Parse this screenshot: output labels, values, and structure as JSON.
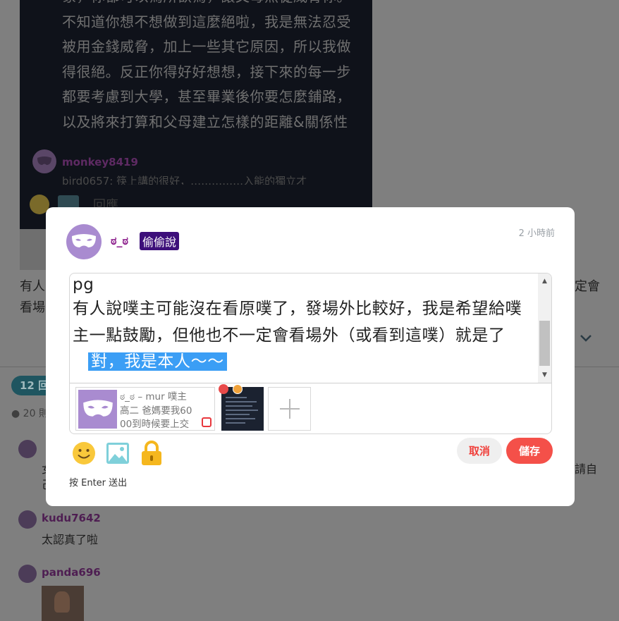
{
  "background": {
    "post_text_lines": [
      "象，你都可以為所欲為，讓父母無從威脅你。",
      "不知道你想不想做到這麼絕啦，我是無法忍受",
      "被用金錢威脅，加上一些其它原因，所以我做",
      "得很絕。反正你得好好想想，接下來的每一步",
      "都要考慮到大學，甚至畢業後你要怎麼鋪路，",
      "以及將來打算和父母建立怎樣的距離&關係性"
    ],
    "card_comment_user": "monkey8419",
    "card_comment_text": "bird0657: 筷上講的很好，……………入能的獨立才",
    "reply_label": "回應",
    "left_fragment_1": "有人",
    "left_fragment_2": "看場",
    "right_fragment": "定會",
    "responses_badge": "12 回",
    "views": "20 則",
    "comment1_body": "女",
    "comment1_body2": "己",
    "comment1_right": "請自",
    "comment2_user": "kudu7642",
    "comment2_body": "太認真了啦",
    "comment3_user": "panda696"
  },
  "modal": {
    "username": "ಠ_ಠ",
    "badge": "偷偷說",
    "time": "2 小時前",
    "editor": {
      "line1": "pg",
      "line2": "有人說噗主可能沒在看原噗了，發場外比較好，我是希望給噗主一點鼓勵，但他也不一定會看場外（或看到這噗）就是了",
      "selected": "對，我是本人～～"
    },
    "attachment": {
      "meta_line1": "ಠ_ಠ – mur 噗主",
      "meta_line2": "高二 爸媽要我60",
      "meta_line3": "00到時候要上交"
    },
    "hint": "按 Enter 送出",
    "cancel_label": "取消",
    "save_label": "儲存"
  },
  "colors": {
    "accent": "#f45049",
    "selection": "#3b9ef5",
    "badge": "#3d0f7a",
    "avatar": "#a98bd0"
  }
}
